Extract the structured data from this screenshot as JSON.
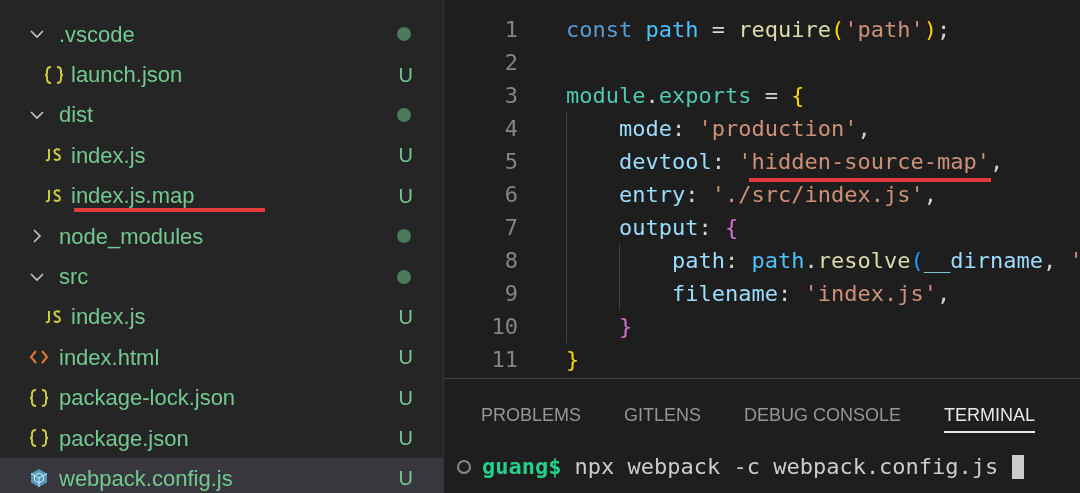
{
  "explorer": {
    "items": [
      {
        "kind": "folder",
        "name": ".vscode",
        "expanded": true,
        "modified": true,
        "children": [
          {
            "kind": "json",
            "name": "launch.json",
            "badge": "U",
            "selected": false,
            "underlined": false
          }
        ]
      },
      {
        "kind": "folder",
        "name": "dist",
        "expanded": true,
        "modified": true,
        "children": [
          {
            "kind": "js",
            "name": "index.js",
            "badge": "U",
            "selected": false,
            "underlined": false
          },
          {
            "kind": "js",
            "name": "index.js.map",
            "badge": "U",
            "selected": false,
            "underlined": true
          }
        ]
      },
      {
        "kind": "folder",
        "name": "node_modules",
        "expanded": false,
        "modified": true
      },
      {
        "kind": "folder",
        "name": "src",
        "expanded": true,
        "modified": true,
        "children": [
          {
            "kind": "js",
            "name": "index.js",
            "badge": "U",
            "selected": false,
            "underlined": false
          }
        ]
      },
      {
        "kind": "html",
        "name": "index.html",
        "badge": "U",
        "selected": false,
        "underlined": false
      },
      {
        "kind": "json",
        "name": "package-lock.json",
        "badge": "U",
        "selected": false,
        "underlined": false
      },
      {
        "kind": "json",
        "name": "package.json",
        "badge": "U",
        "selected": false,
        "underlined": false
      },
      {
        "kind": "webpack",
        "name": "webpack.config.js",
        "badge": "U",
        "selected": true,
        "underlined": false
      }
    ]
  },
  "editor": {
    "lines": [
      {
        "number": "1",
        "underlined": false,
        "tokens": [
          {
            "kind": "keyword",
            "s": "const "
          },
          {
            "kind": "variable",
            "s": "path"
          },
          {
            "kind": "punct",
            "s": " = "
          },
          {
            "kind": "func",
            "s": "require"
          },
          {
            "kind": "bracket1",
            "s": "("
          },
          {
            "kind": "string",
            "s": "'path'"
          },
          {
            "kind": "bracket1",
            "s": ")"
          },
          {
            "kind": "punct",
            "s": ";"
          }
        ]
      },
      {
        "number": "2",
        "underlined": false
      },
      {
        "number": "3",
        "underlined": false,
        "tokens": [
          {
            "kind": "module",
            "s": "module"
          },
          {
            "kind": "punct",
            "s": "."
          },
          {
            "kind": "module",
            "s": "exports"
          },
          {
            "kind": "punct",
            "s": " = "
          },
          {
            "kind": "bracket1",
            "s": "{"
          }
        ],
        "children": [
          {
            "number": "4",
            "underlined": false,
            "tokens": [
              {
                "kind": "property",
                "s": "mode"
              },
              {
                "kind": "punct",
                "s": ": "
              },
              {
                "kind": "string",
                "s": "'production'"
              },
              {
                "kind": "punct",
                "s": ","
              }
            ]
          },
          {
            "number": "5",
            "underlined": true,
            "tokens": [
              {
                "kind": "property",
                "s": "devtool"
              },
              {
                "kind": "punct",
                "s": ": "
              },
              {
                "kind": "string",
                "s": "'hidden-source-map'"
              },
              {
                "kind": "punct",
                "s": ","
              }
            ]
          },
          {
            "number": "6",
            "underlined": false,
            "tokens": [
              {
                "kind": "property",
                "s": "entry"
              },
              {
                "kind": "punct",
                "s": ": "
              },
              {
                "kind": "string",
                "s": "'./src/index.js'"
              },
              {
                "kind": "punct",
                "s": ","
              }
            ]
          },
          {
            "number": "7",
            "underlined": false,
            "tokens": [
              {
                "kind": "property",
                "s": "output"
              },
              {
                "kind": "punct",
                "s": ": "
              },
              {
                "kind": "bracket2",
                "s": "{"
              }
            ],
            "children": [
              {
                "number": "8",
                "underlined": false,
                "tokens": [
                  {
                    "kind": "property",
                    "s": "path"
                  },
                  {
                    "kind": "punct",
                    "s": ": "
                  },
                  {
                    "kind": "variable",
                    "s": "path"
                  },
                  {
                    "kind": "punct",
                    "s": "."
                  },
                  {
                    "kind": "func",
                    "s": "resolve"
                  },
                  {
                    "kind": "bracket3",
                    "s": "("
                  },
                  {
                    "kind": "property",
                    "s": "__dirname"
                  },
                  {
                    "kind": "punct",
                    "s": ", "
                  },
                  {
                    "kind": "string",
                    "s": "'"
                  }
                ]
              },
              {
                "number": "9",
                "underlined": false,
                "tokens": [
                  {
                    "kind": "property",
                    "s": "filename"
                  },
                  {
                    "kind": "punct",
                    "s": ": "
                  },
                  {
                    "kind": "string",
                    "s": "'index.js'"
                  },
                  {
                    "kind": "punct",
                    "s": ","
                  }
                ]
              }
            ]
          },
          {
            "number": "10",
            "underlined": false,
            "tokens": [
              {
                "kind": "bracket2",
                "s": "}"
              }
            ]
          }
        ]
      },
      {
        "number": "11",
        "underlined": false,
        "tokens": [
          {
            "kind": "bracket1",
            "s": "}"
          }
        ]
      }
    ]
  },
  "panel": {
    "tabs": [
      {
        "label": "PROBLEMS",
        "selected": false
      },
      {
        "label": "GITLENS",
        "selected": false
      },
      {
        "label": "DEBUG CONSOLE",
        "selected": false
      },
      {
        "label": "TERMINAL",
        "selected": true
      }
    ],
    "terminal": {
      "prompt": "guang$",
      "command": "npx webpack -c webpack.config.js"
    }
  }
}
